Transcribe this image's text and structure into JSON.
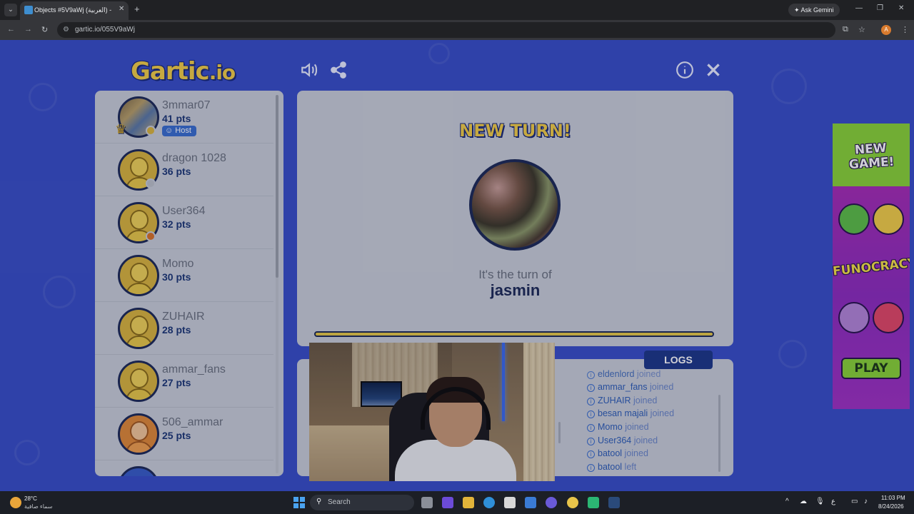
{
  "browser": {
    "tab_title": "Objects #5V9aWj (العربية) -",
    "ask_gemini": "Ask Gemini",
    "url": "gartic.io/055V9aWj",
    "profile_initial": "A"
  },
  "game": {
    "logo_main": "Gartic",
    "logo_suffix": ".io",
    "players": [
      {
        "name": "3mmar07",
        "points": "41 pts",
        "badge": "Host",
        "status_color": "#d9b540",
        "avatar": "photo"
      },
      {
        "name": "dragon 1028",
        "points": "36 pts",
        "status_color": "#bcc1ca",
        "avatar": "yellow"
      },
      {
        "name": "User364",
        "points": "32 pts",
        "status_color": "#d9742a",
        "avatar": "yellow"
      },
      {
        "name": "Momo",
        "points": "30 pts",
        "avatar": "yellow"
      },
      {
        "name": "ZUHAIR",
        "points": "28 pts",
        "avatar": "yellow"
      },
      {
        "name": "ammar_fans",
        "points": "27 pts",
        "avatar": "yellow"
      },
      {
        "name": "506_ammar",
        "points": "25 pts",
        "avatar": "orange"
      }
    ],
    "turn": {
      "heading": "NEW TURN!",
      "label": "It's the turn of",
      "player": "jasmin"
    },
    "logs": {
      "tab_label": "LOGS",
      "entries": [
        {
          "who": "eldenlord",
          "action": "joined"
        },
        {
          "who": "ammar_fans",
          "action": "joined"
        },
        {
          "who": "ZUHAIR",
          "action": "joined"
        },
        {
          "who": "besan majali",
          "action": "joined"
        },
        {
          "who": "Momo",
          "action": "joined"
        },
        {
          "who": "User364",
          "action": "joined"
        },
        {
          "who": "batool",
          "action": "joined"
        },
        {
          "who": "batool",
          "action": "left"
        }
      ]
    }
  },
  "ad": {
    "headline_1": "NEW",
    "headline_2": "GAME!",
    "brand": "FUNOCRACY",
    "cta": "PLAY"
  },
  "taskbar": {
    "temperature": "28°C",
    "weather_desc": "سماء صافية",
    "search_label": "Search",
    "time": "11:03 PM",
    "date": "8/24/2026"
  }
}
